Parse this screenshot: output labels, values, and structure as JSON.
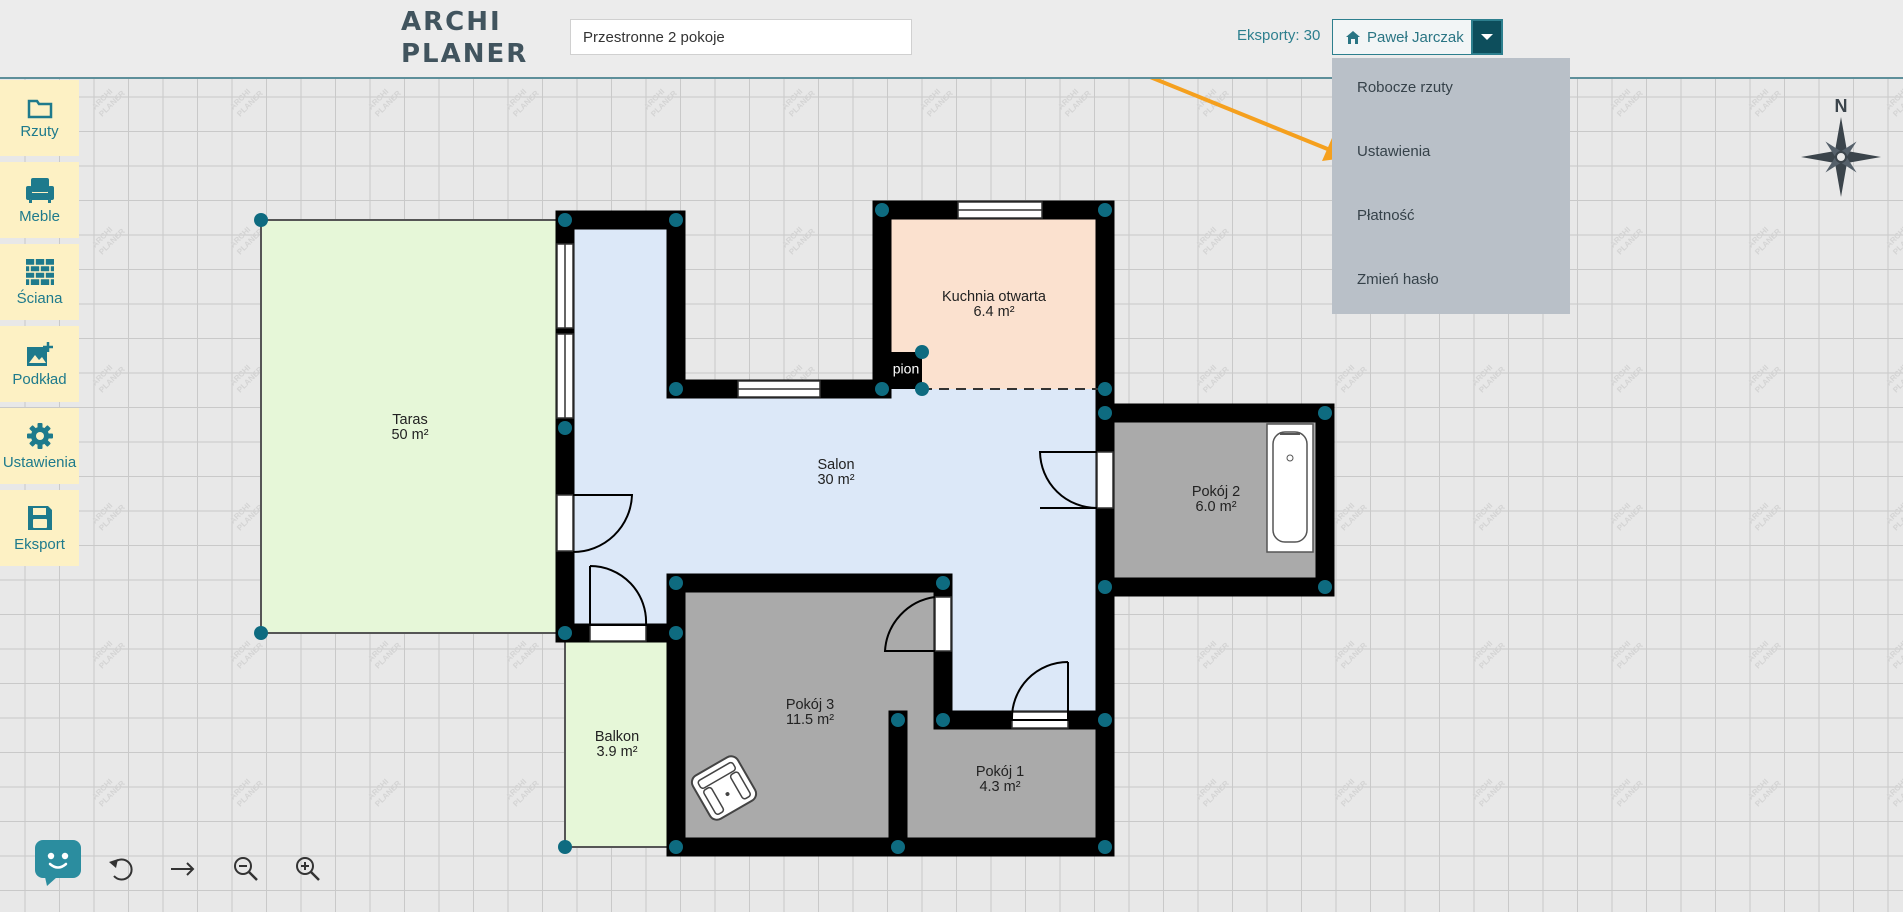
{
  "header": {
    "logo_line1": "ARCHI",
    "logo_line2": "PLANER",
    "project_title": "Przestronne 2 pokoje",
    "exports_label": "Eksporty: 30",
    "user_name": "Paweł Jarczak"
  },
  "user_menu": {
    "items": [
      "Robocze rzuty",
      "Ustawienia",
      "Płatność",
      "Zmień hasło"
    ]
  },
  "sidebar": {
    "items": [
      {
        "label": "Rzuty",
        "icon": "folder-icon"
      },
      {
        "label": "Meble",
        "icon": "armchair-icon"
      },
      {
        "label": "Ściana",
        "icon": "brick-wall-icon"
      },
      {
        "label": "Podkład",
        "icon": "image-add-icon"
      },
      {
        "label": "Ustawienia",
        "icon": "gear-icon"
      },
      {
        "label": "Eksport",
        "icon": "floppy-disk-icon"
      }
    ]
  },
  "compass": {
    "label": "N"
  },
  "plan": {
    "watermark": [
      "ARCHI",
      "PLANER"
    ],
    "shaft_label": "pion",
    "rooms": [
      {
        "name": "Taras",
        "area": "50 m²",
        "color": "#e6f7d8"
      },
      {
        "name": "Salon",
        "area": "30 m²",
        "color": "#dce8f8"
      },
      {
        "name": "Kuchnia otwarta",
        "area": "6.4 m²",
        "color": "#fbe1cf"
      },
      {
        "name": "Pokój 2",
        "area": "6.0 m²",
        "color": "#aaaaaa"
      },
      {
        "name": "Pokój 3",
        "area": "11.5 m²",
        "color": "#aaaaaa"
      },
      {
        "name": "Balkon",
        "area": "3.9 m²",
        "color": "#e6f7d8"
      },
      {
        "name": "Pokój 1",
        "area": "4.3 m²",
        "color": "#aaaaaa"
      }
    ]
  },
  "toolbar": {
    "tools": [
      {
        "name": "chatbot",
        "icon": "chatbot-face-icon"
      },
      {
        "name": "undo",
        "icon": "undo-icon"
      },
      {
        "name": "redo",
        "icon": "arrow-right-icon"
      },
      {
        "name": "zoom-out",
        "icon": "zoom-out-icon"
      },
      {
        "name": "zoom-in",
        "icon": "zoom-in-icon"
      }
    ]
  },
  "colors": {
    "accent": "#1e7a8c",
    "sidebar_bg": "#fdf1c4",
    "wall": "#000000",
    "node": "#0e6b80",
    "annotation_arrow": "#f5a01e",
    "menu_bg": "#b9c0c8"
  }
}
